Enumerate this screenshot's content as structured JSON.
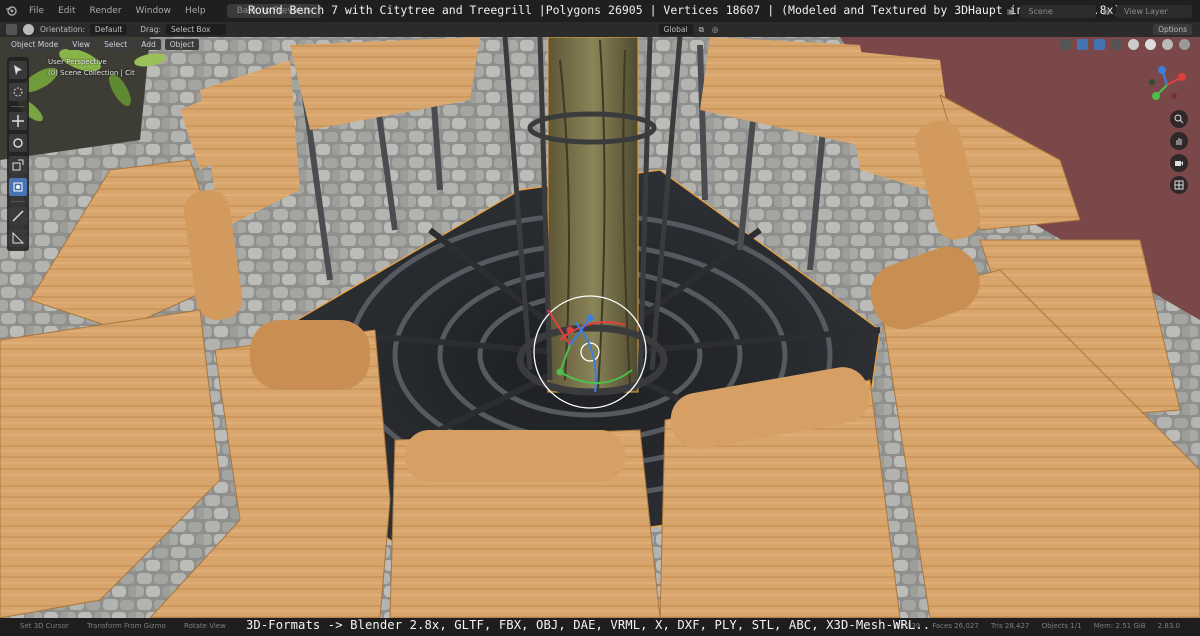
{
  "menubar": {
    "items": [
      "File",
      "Edit",
      "Render",
      "Window",
      "Help"
    ],
    "back_button": "Back to Previous",
    "title": "Round Bench 7 with Citytree and Treegrill |Polygons 26905 | Vertices 18607 | (Modeled and  Textured by 3DHaupt in Blender-2.8x)",
    "scene_label": "Scene",
    "view_layer_label": "View Layer"
  },
  "toolbar1": {
    "orientation_label": "Orientation:",
    "orientation_value": "Default",
    "drag_label": "Drag:",
    "drag_value": "Select Box",
    "transform_value": "Global",
    "options_label": "Options"
  },
  "toolbar2": {
    "mode": "Object Mode",
    "menus": [
      "View",
      "Select",
      "Add",
      "Object"
    ]
  },
  "viewport": {
    "perspective_label": "User Perspective",
    "collection_label": "(0) Scene Collection | Cit"
  },
  "statusbar": {
    "left_items": [
      "Set 3D Cursor",
      "Transform From Gizmo",
      "Rotate View"
    ],
    "right_items": [
      "18,839",
      "Faces 26,027",
      "Tris 28,427",
      "Objects 1/1",
      "Mem: 2.51 GiB",
      "2.83.0"
    ],
    "formats_caption": "3D-Formats -> Blender 2.8x, GLTF, FBX, OBJ, DAE, VRML, X, DXF, PLY, STL, ABC, X3D-Mesh-WRL.."
  },
  "colors": {
    "accent_selection": "#f0a23a",
    "active_tool": "#4772b3",
    "wood": "#d9a56a",
    "metal": "#4a4d50",
    "cobble": "#9a9a98"
  },
  "icons": {
    "tools": [
      "select-box-icon",
      "cursor-icon",
      "move-icon",
      "rotate-icon",
      "scale-icon",
      "transform-icon",
      "annotate-icon",
      "measure-icon"
    ],
    "nav": [
      "zoom-icon",
      "hand-pan-icon",
      "camera-icon",
      "grid-icon"
    ]
  }
}
